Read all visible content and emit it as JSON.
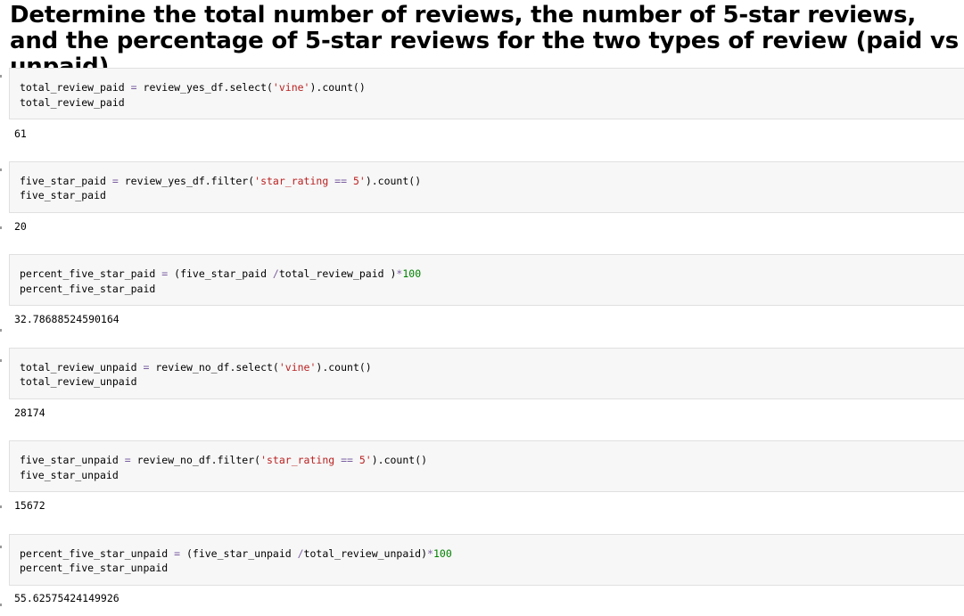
{
  "heading": "Determine the total number of reviews, the number of 5-star reviews, and the percentage of 5-star reviews for the two types of review (paid vs unpaid).",
  "colors": {
    "string": "#ba2121",
    "number": "#008000",
    "operator": "#7a5ea0",
    "cell_background": "#f7f7f7"
  },
  "cells": [
    {
      "line1": {
        "lhs": "total_review_paid",
        "op": "=",
        "pre": "review_yes_df.select(",
        "str": "'vine'",
        "post": ").count()"
      },
      "line2": "total_review_paid",
      "output": "61"
    },
    {
      "line1": {
        "lhs": "five_star_paid",
        "op": "=",
        "pre": "review_yes_df.filter(",
        "str1": "'star_rating ",
        "op2": "==",
        "str2": " 5'",
        "post": ").count()"
      },
      "line2": "five_star_paid",
      "output": "20"
    },
    {
      "line1": {
        "lhs": "percent_five_star_paid",
        "op": "=",
        "pre": "(five_star_paid ",
        "op2": "/",
        "mid": "total_review_paid )",
        "op3": "*",
        "num": "100"
      },
      "line2": "percent_five_star_paid",
      "output": "32.78688524590164"
    },
    {
      "line1": {
        "lhs": "total_review_unpaid",
        "op": "=",
        "pre": "review_no_df.select(",
        "str": "'vine'",
        "post": ").count()"
      },
      "line2": "total_review_unpaid",
      "output": "28174"
    },
    {
      "line1": {
        "lhs": "five_star_unpaid",
        "op": "=",
        "pre": "review_no_df.filter(",
        "str1": "'star_rating ",
        "op2": "==",
        "str2": " 5'",
        "post": ").count()"
      },
      "line2": "five_star_unpaid",
      "output": "15672"
    },
    {
      "line1": {
        "lhs": "percent_five_star_unpaid",
        "op": "=",
        "pre": "(five_star_unpaid ",
        "op2": "/",
        "mid": "total_review_unpaid)",
        "op3": "*",
        "num": "100"
      },
      "line2": "percent_five_star_unpaid",
      "output": "55.62575424149926"
    }
  ]
}
